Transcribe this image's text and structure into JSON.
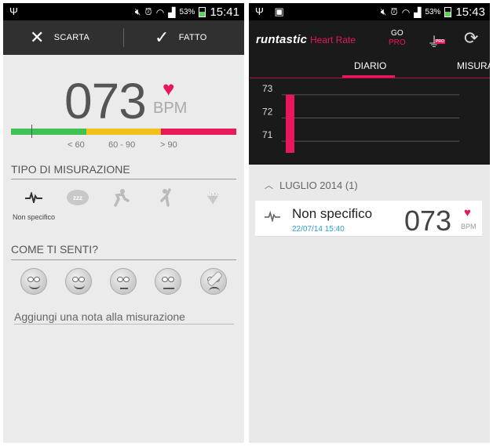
{
  "left": {
    "status": {
      "icons": [
        "usb-icon"
      ],
      "battery": "53%",
      "time": "15:41"
    },
    "actionbar": {
      "discard_label": "SCARTA",
      "done_label": "FATTO"
    },
    "reading": {
      "value": "073",
      "unit": "BPM"
    },
    "zones": {
      "labels": [
        "< 60",
        "60 - 90",
        "> 90"
      ],
      "colors": [
        "#3ec255",
        "#f2c21c",
        "#e8195b"
      ]
    },
    "measure_type": {
      "title": "TIPO DI MISURAZIONE",
      "selected_label": "Non specifico",
      "icons": [
        "heartbeat-icon",
        "sleep-icon",
        "running-icon",
        "stretching-icon",
        "max-heart-icon"
      ],
      "sleep_text": "zzz",
      "max_text": "MAX"
    },
    "feeling": {
      "title": "COME TI SENTI?",
      "moods": [
        "very-happy-icon",
        "happy-icon",
        "neutral-icon",
        "sad-icon",
        "injured-icon"
      ]
    },
    "note": {
      "placeholder": "Aggiungi una nota alla misurazione"
    }
  },
  "right": {
    "status": {
      "battery": "53%",
      "time": "15:43"
    },
    "app": {
      "brand": "runtastic",
      "brand_sub": "Heart Rate",
      "gopro_top": "GO",
      "gopro_bottom": "PRO",
      "filter_badge": "PRO"
    },
    "tabs": [
      {
        "label": "DIARIO"
      },
      {
        "label": "MISURA"
      }
    ],
    "chart_data": {
      "type": "bar",
      "ylabels": [
        "73",
        "72",
        "71"
      ],
      "values": [
        73
      ],
      "ylim": [
        70.5,
        73.2
      ],
      "bar_color": "#e8175d"
    },
    "group": {
      "label": "LUGLIO 2014 (1)"
    },
    "entry": {
      "type": "Non specifico",
      "time": "22/07/14 15:40",
      "value": "073",
      "unit": "BPM"
    }
  },
  "colors": {
    "accent": "#e8175d",
    "link": "#2a9fd6"
  }
}
